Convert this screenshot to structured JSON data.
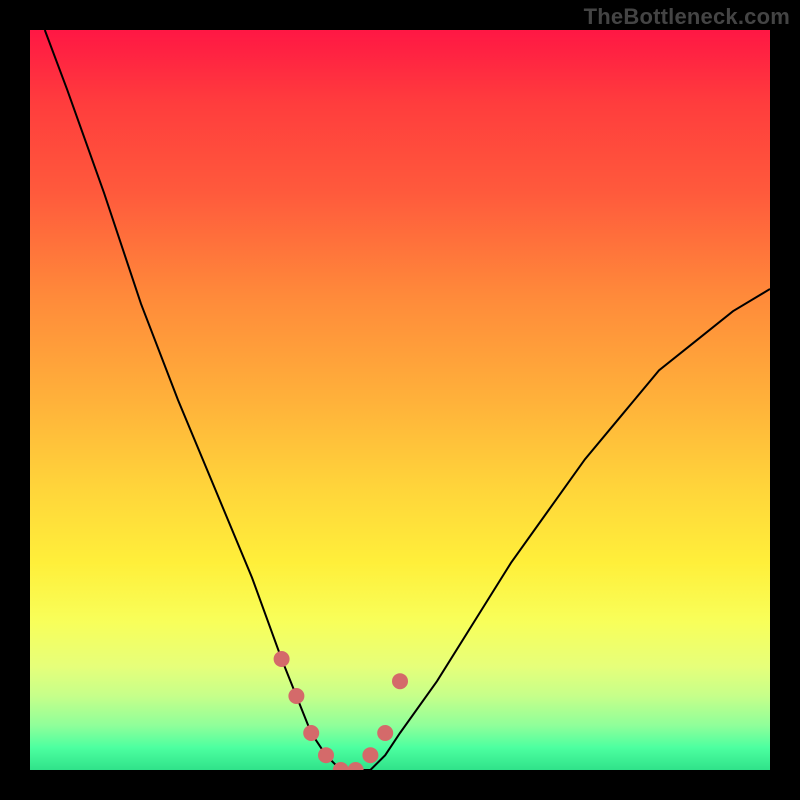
{
  "watermark": "TheBottleneck.com",
  "chart_data": {
    "type": "line",
    "title": "",
    "xlabel": "",
    "ylabel": "",
    "xlim": [
      0,
      100
    ],
    "ylim": [
      0,
      100
    ],
    "grid": false,
    "legend": false,
    "background_gradient": {
      "direction": "vertical",
      "stops": [
        {
          "pos": 0,
          "color": "#ff1744"
        },
        {
          "pos": 50,
          "color": "#ffd53a"
        },
        {
          "pos": 100,
          "color": "#30e28a"
        }
      ]
    },
    "series": [
      {
        "name": "bottleneck-curve",
        "color": "#000000",
        "x": [
          2,
          5,
          10,
          15,
          20,
          25,
          30,
          34,
          36,
          38,
          40,
          42,
          44,
          46,
          48,
          50,
          55,
          60,
          65,
          70,
          75,
          80,
          85,
          90,
          95,
          100
        ],
        "y": [
          100,
          92,
          78,
          63,
          50,
          38,
          26,
          15,
          10,
          5,
          2,
          0,
          0,
          0,
          2,
          5,
          12,
          20,
          28,
          35,
          42,
          48,
          54,
          58,
          62,
          65
        ]
      }
    ],
    "marker_points": {
      "name": "trough-markers",
      "color": "#d46a6a",
      "radius_px": 8,
      "x": [
        34,
        36,
        38,
        40,
        42,
        44,
        46,
        48,
        50
      ],
      "y": [
        15,
        10,
        5,
        2,
        0,
        0,
        2,
        5,
        12
      ]
    }
  }
}
